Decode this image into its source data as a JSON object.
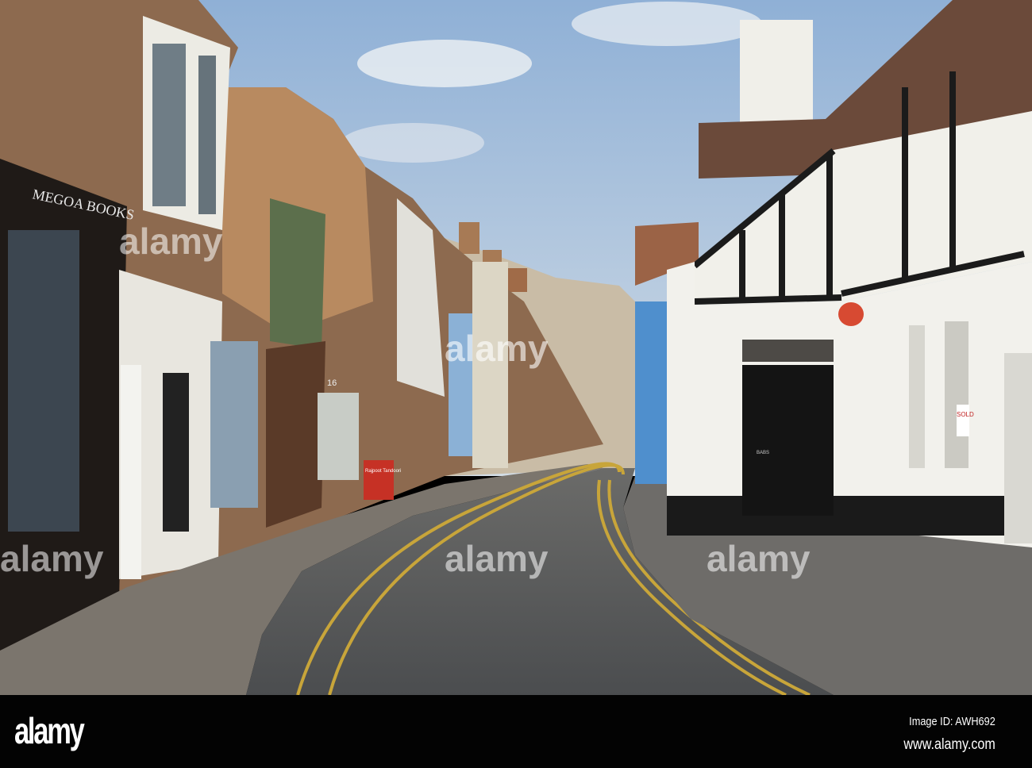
{
  "photo": {
    "shop_sign": "MEGOA BOOKS",
    "restaurant_sign": "Rajpoot Tandoori",
    "house_number": "16",
    "door_label": "BABS",
    "sale_sign": "SOLD"
  },
  "watermark": "alamy",
  "footer": {
    "logo": "alamy",
    "image_id": "Image ID: AWH692",
    "website": "www.alamy.com"
  },
  "colors": {
    "sky": "#a9c3df",
    "road": "#56585a",
    "yellow_line": "#c8a53a",
    "footer": "#030303"
  }
}
